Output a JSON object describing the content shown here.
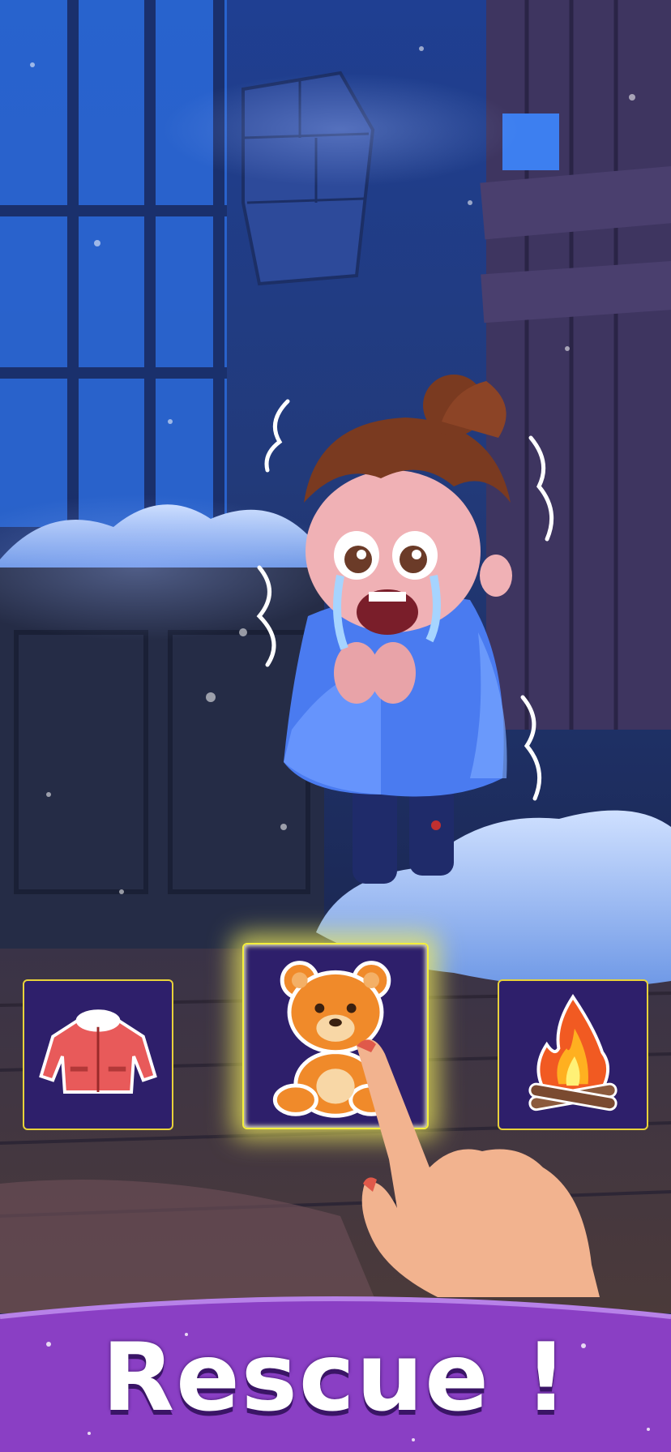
{
  "banner": {
    "title": "Rescue !",
    "color": "#8a3fc4"
  },
  "choices": [
    {
      "item": "red-winter-jacket",
      "selected": false
    },
    {
      "item": "teddy-bear",
      "selected": true
    },
    {
      "item": "campfire",
      "selected": false
    }
  ],
  "colors": {
    "card_fill": "#2e1f6b",
    "card_border": "#e8d23a",
    "selection_glow": "#f4ef3c",
    "night_sky": "#1d3a8a"
  }
}
